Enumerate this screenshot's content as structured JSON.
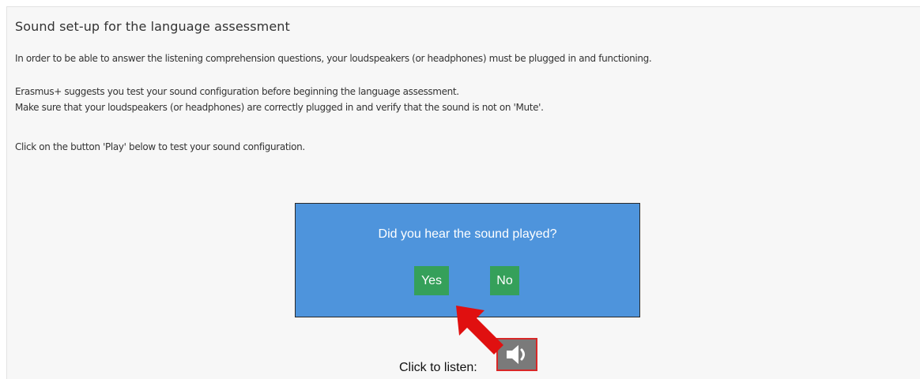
{
  "header": {
    "title": "Sound set-up for the language assessment"
  },
  "instructions": {
    "p1": "In order to be able to answer the listening comprehension questions, your loudspeakers (or headphones) must be plugged in and functioning.",
    "p2": "Erasmus+ suggests you test your sound configuration before beginning the language assessment.",
    "p3": "Make sure that your loudspeakers (or headphones) are correctly plugged in and verify that the sound is not on 'Mute'.",
    "p4": "Click on the button 'Play' below to test your sound configuration."
  },
  "dialog": {
    "question": "Did you hear the sound played?",
    "yes_label": "Yes",
    "no_label": "No",
    "background_color": "#4e94dc",
    "button_color": "#35a05a"
  },
  "player": {
    "label": "Click to listen:",
    "icon": "speaker-icon"
  },
  "annotation": {
    "icon": "red-arrow-icon",
    "color": "#e01010"
  }
}
